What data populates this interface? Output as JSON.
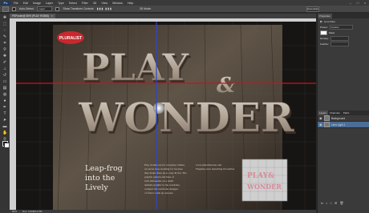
{
  "menubar": {
    "logo": "Ps",
    "items": [
      "File",
      "Edit",
      "Image",
      "Layer",
      "Type",
      "Select",
      "Filter",
      "3D",
      "View",
      "Window",
      "Help"
    ]
  },
  "options": {
    "auto_select_label": "Auto-Select:",
    "auto_select_value": "Layer",
    "show_transform_label": "Show Transform Controls",
    "mode_label": "3D Mode:",
    "workspace": "Essentials"
  },
  "document": {
    "tab_title": "PSPoster@ 50% (PLAY, RGB/8)",
    "close_glyph": "×"
  },
  "canvas_art": {
    "badge": "PLURALIST",
    "play_word": "PLAY",
    "amp": "&",
    "wonder_word": "WONDER",
    "tagline": [
      "Leap-frog",
      "into the",
      "Lively"
    ],
    "body_text": [
      "Play clothes are for everyday clothes",
      "we never stop reaching for because",
      "they make dress up so easy & fun. The",
      "graphic pattern and hues of",
      "bold silhouettes on a small",
      "animals graphic in the wardrobe,",
      "compact the wardrobe changes",
      "of follow wide up seasons."
    ],
    "url_text": [
      "www.pluralistwear.com",
      "Flagship store launching November"
    ],
    "thumb_play": "PLAY&",
    "thumb_wonder": "WONDER"
  },
  "status": {
    "zoom": "50%",
    "doc": "Doc: 3.00M/12.5M"
  },
  "panels": {
    "top_tabs": [
      "Properties"
    ],
    "sub_label": "Lens Flare",
    "preset_label": "Preset:",
    "preset_value": "Custom",
    "mask_label": "Mask",
    "density_label": "Density:",
    "feather_label": "Feather:",
    "layers_tabs": [
      "Layers",
      "Channels",
      "Paths"
    ],
    "layers": [
      {
        "name": "Background",
        "selected": false
      },
      {
        "name": "Lens Light 1",
        "selected": true
      }
    ],
    "bottom_buttons": [
      "fx",
      "◐",
      "□",
      "⊞",
      "🗑"
    ]
  },
  "colors": {
    "guide_red": "#d0101a",
    "guide_blue": "#2e46c8",
    "badge_red": "#c8282e",
    "selected_layer": "#4b6d96"
  }
}
